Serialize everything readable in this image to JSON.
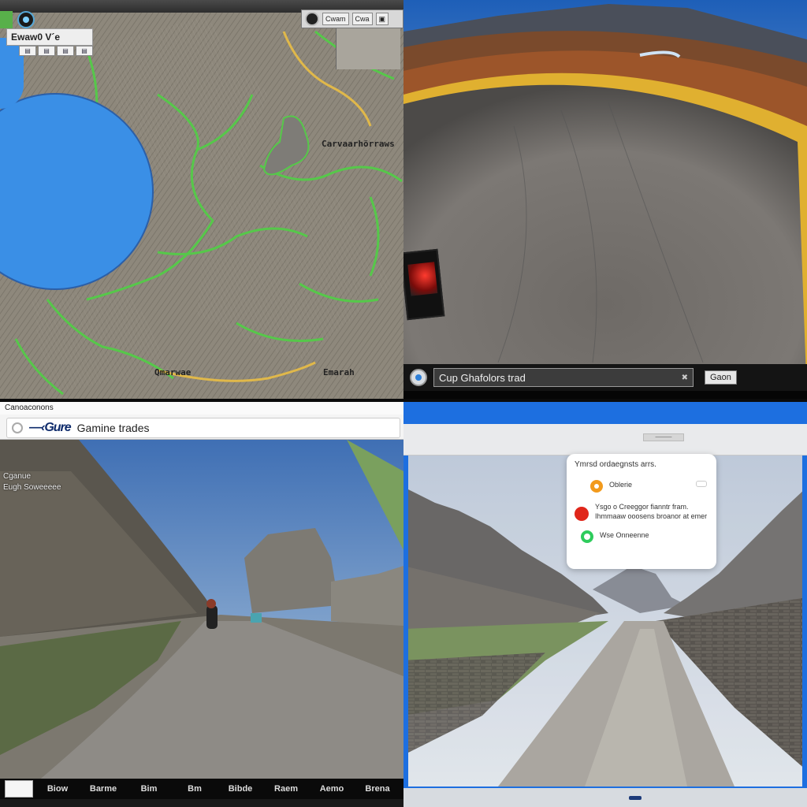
{
  "map_view": {
    "search_text": "Ewaw0 V´e",
    "chips": [
      "▤",
      "▤",
      "▤",
      "▤"
    ],
    "toolbar": {
      "btn1": "Cwam",
      "btn2": "Cwa",
      "btn3": "▣"
    },
    "labels": {
      "label_mid": "Carvaarhörraws",
      "label_bl": "Qmarwae",
      "label_br": "Emarah"
    },
    "colors": {
      "lake": "#3a8fe6",
      "contour": "#56c84a",
      "trail": "#e0b84a"
    }
  },
  "fisheye_view": {
    "location_field": "Cup Ghafolors trad",
    "field_close": "✖",
    "button": "Gaon",
    "colors": {
      "road": "#6a6a6a",
      "sky": "#2c6fbf",
      "rim": "#e1b030"
    }
  },
  "street_view": {
    "window_title": "Canoaconons",
    "logo": "—‹Gure",
    "address": "Gamine trades",
    "overlay_lines": [
      "Cganue",
      "Eugh Soweeeee"
    ],
    "bottom_items": [
      "Biow",
      "Barme",
      "Bim",
      "Bm",
      "Bibde",
      "Raem",
      "Aemo",
      "Brena"
    ]
  },
  "canyon_view": {
    "tab": "———",
    "dialog": {
      "title": "Ymrsd ordaegnsts arrs.",
      "rows": [
        {
          "icon": "orange-pin-icon",
          "text": "Oblerie"
        },
        {
          "icon": "red-dot-icon",
          "text": "Ysgo o Creeggor fianntr fram. Ihmmaaw ooosens broanor at emer"
        },
        {
          "icon": "green-pin-icon",
          "text": "Wse Onneenne"
        }
      ]
    }
  }
}
